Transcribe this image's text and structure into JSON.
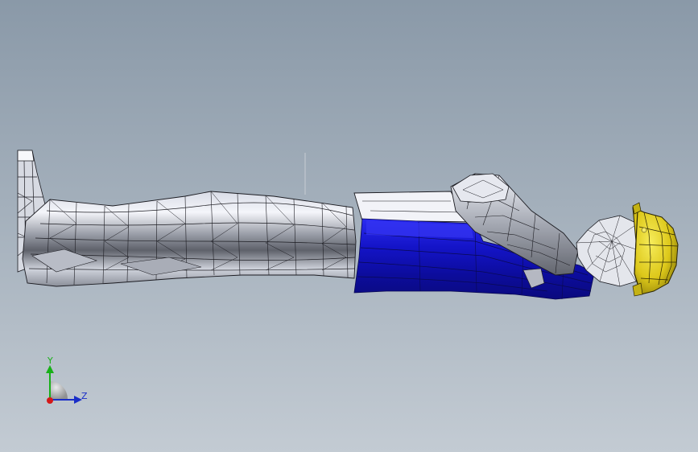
{
  "colors": {
    "background_top": "#8a99a8",
    "background_bottom": "#c3cbd3",
    "garment_light": "#eef0f6",
    "garment_shade": "#6c6f78",
    "vest_blue": "#1212c8",
    "vest_dark": "#0a0a86",
    "helmet_yellow": "#e2d21c",
    "mesh_lines": "#1c1c22",
    "axis_y": "#18b018",
    "axis_z": "#1a2ec8",
    "axis_x": "#d41818"
  },
  "view": {
    "model": "worker-mannequin-lying",
    "icons": [
      "triad-icon"
    ]
  },
  "triad": {
    "y_label": "Y",
    "z_label": "Z"
  }
}
